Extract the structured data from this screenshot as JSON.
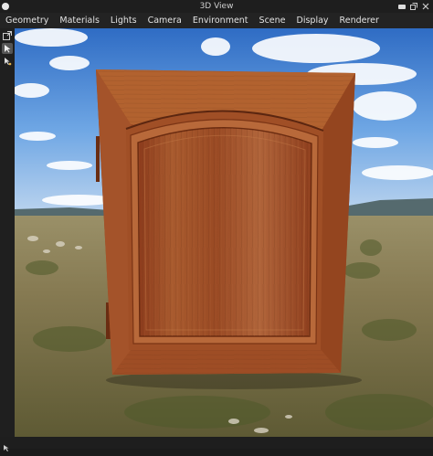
{
  "window": {
    "title": "3D View"
  },
  "menu": [
    "Geometry",
    "Materials",
    "Lights",
    "Camera",
    "Environment",
    "Scene",
    "Display",
    "Renderer"
  ],
  "toolbar": {
    "tools": [
      "expand-icon",
      "select-arrow-icon",
      "move-cursor-icon"
    ]
  },
  "window_buttons": [
    "pin-icon",
    "restore-icon",
    "close-icon"
  ],
  "viewport": {
    "subject": "cabinet-door-model",
    "environment": "sky-grassland"
  },
  "colors": {
    "chrome": "#1e1e1e",
    "menubar": "#232323",
    "wood": "#a4532a",
    "sky": "#3f7fd0"
  }
}
